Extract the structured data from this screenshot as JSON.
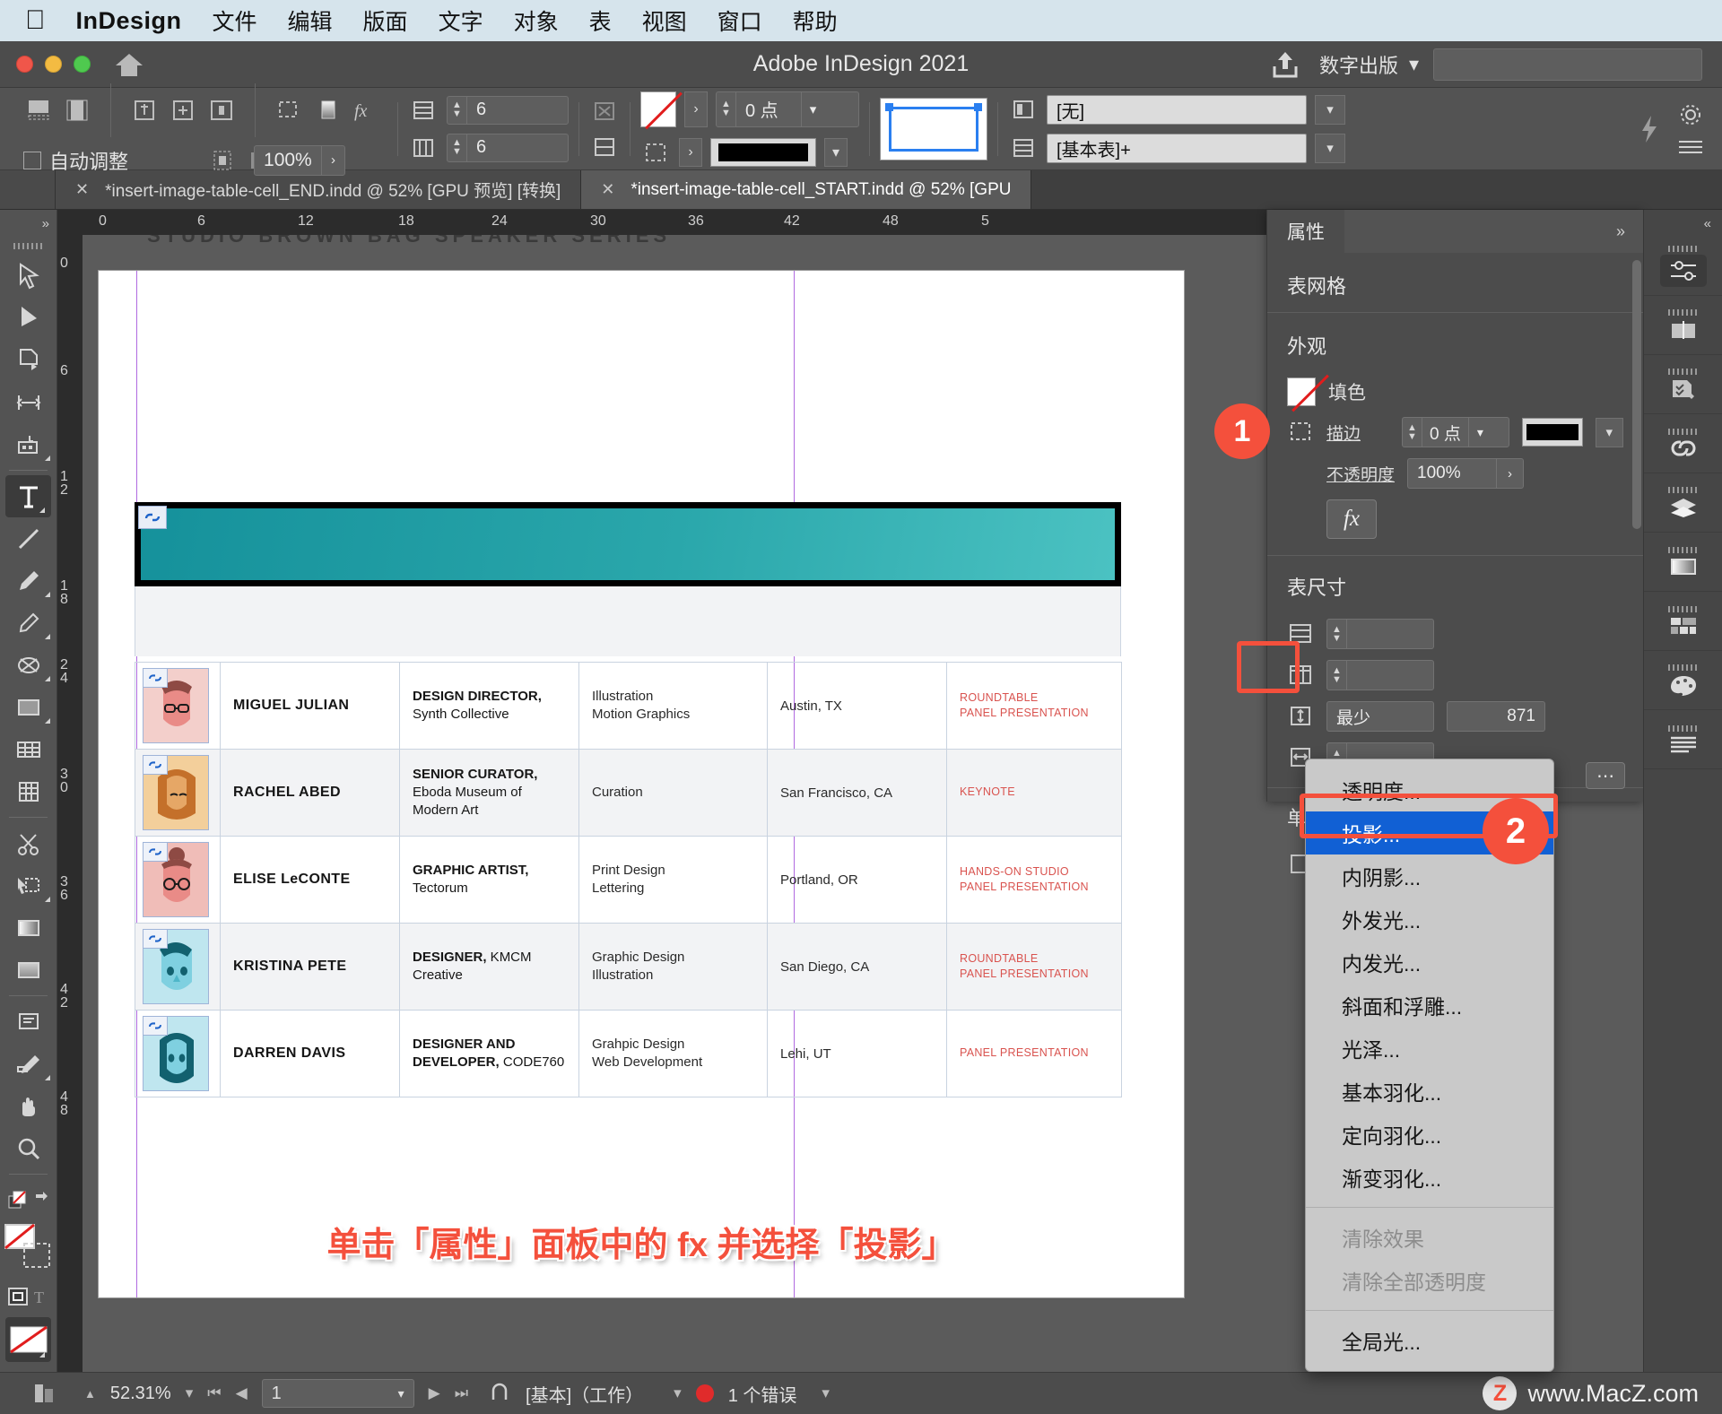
{
  "macbar": {
    "apple_icon": "apple-icon",
    "app_name": "InDesign",
    "menus": [
      "文件",
      "编辑",
      "版面",
      "文字",
      "对象",
      "表",
      "视图",
      "窗口",
      "帮助"
    ]
  },
  "titlebar": {
    "title": "Adobe InDesign 2021",
    "share_icon": "share-icon",
    "home_icon": "home-icon",
    "workspace": "数字出版",
    "search_placeholder": ""
  },
  "control_bar": {
    "auto_fit_label": "自动调整",
    "scale_value": "100%",
    "rows_value": "6",
    "cols_value": "6",
    "stroke_weight": "0 点",
    "object_style": "[无]",
    "table_style": "[基本表]+",
    "fill_swatch": "none-swatch",
    "stroke_swatch": "black-swatch"
  },
  "tabs": [
    {
      "label": "*insert-image-table-cell_END.indd @ 52% [GPU 预览] [转换]",
      "active": false
    },
    {
      "label": "*insert-image-table-cell_START.indd @ 52% [GPU",
      "active": true
    }
  ],
  "tools": [
    "selection-tool",
    "direct-selection-tool",
    "page-tool",
    "gap-tool",
    "content-collector-tool",
    "type-tool",
    "line-tool",
    "pen-tool",
    "pencil-tool",
    "ellipse-frame-tool",
    "rectangle-tool",
    "table-tool",
    "column-tool",
    "scissors-tool",
    "free-transform-tool",
    "gradient-swatch-tool",
    "gradient-feather-tool",
    "note-tool",
    "eyedropper-tool",
    "hand-tool",
    "zoom-tool"
  ],
  "rulers": {
    "horizontal_ticks": [
      "0",
      "6",
      "12",
      "18",
      "24",
      "30",
      "36",
      "42",
      "48",
      "5"
    ],
    "vertical_ticks": [
      "0",
      "6",
      "12",
      "18",
      "24",
      "30",
      "36",
      "42",
      "48"
    ]
  },
  "document": {
    "page_header": "STUDIO BROWN BAG SPEAKER SERIES",
    "caption": "单击「属性」面板中的 fx 并选择「投影」",
    "table": {
      "rows": [
        {
          "avatar": "avatar-miguel",
          "name": "MIGUEL JULIAN",
          "role_bold": "DESIGN DIRECTOR,",
          "role_sub": "Synth Collective",
          "skills": [
            "Illustration",
            "Motion Graphics"
          ],
          "location": "Austin, TX",
          "topic": [
            "ROUNDTABLE",
            "PANEL PRESENTATION"
          ]
        },
        {
          "avatar": "avatar-rachel",
          "name": "RACHEL ABED",
          "role_bold": "SENIOR CURATOR,",
          "role_sub": "Eboda Museum of Modern Art",
          "skills": [
            "Curation"
          ],
          "location": "San Francisco, CA",
          "topic": [
            "KEYNOTE"
          ]
        },
        {
          "avatar": "avatar-elise",
          "name": "ELISE LeCONTE",
          "role_bold": "GRAPHIC ARTIST,",
          "role_sub": "Tectorum",
          "skills": [
            "Print Design",
            "Lettering"
          ],
          "location": "Portland, OR",
          "topic": [
            "HANDS-ON STUDIO",
            "PANEL PRESENTATION"
          ]
        },
        {
          "avatar": "avatar-kristina",
          "name": "KRISTINA PETE",
          "role_bold": "DESIGNER,",
          "role_sub_inline": " KMCM",
          "role_sub": "Creative",
          "skills": [
            "Graphic Design",
            "Illustration"
          ],
          "location": "San Diego, CA",
          "topic": [
            "ROUNDTABLE",
            "PANEL PRESENTATION"
          ]
        },
        {
          "avatar": "avatar-darren",
          "name": "DARREN DAVIS",
          "role_bold": "DESIGNER AND DEVELOPER,",
          "role_sub_inline": " CODE760",
          "role_sub": "",
          "skills": [
            "Grahpic Design",
            "Web Development"
          ],
          "location": "Lehi, UT",
          "topic": [
            "PANEL PRESENTATION"
          ]
        }
      ]
    }
  },
  "properties_panel": {
    "tab_label": "属性",
    "collapse_icon": "chevron-double-right-icon",
    "object_type": "表网格",
    "appearance_title": "外观",
    "fill_label": "填色",
    "stroke_label": "描边",
    "stroke_weight": "0 点",
    "opacity_label": "不透明度",
    "opacity_value": "100%",
    "fx_label": "fx",
    "table_size_title": "表尺寸",
    "table_size_min": "最少",
    "table_size_value": "871",
    "cell_inset_title": "单元格内"
  },
  "effects_menu": {
    "items": [
      {
        "label": "透明度...",
        "state": "normal"
      },
      {
        "label": "投影...",
        "state": "highlighted"
      },
      {
        "label": "内阴影...",
        "state": "normal"
      },
      {
        "label": "外发光...",
        "state": "normal"
      },
      {
        "label": "内发光...",
        "state": "normal"
      },
      {
        "label": "斜面和浮雕...",
        "state": "normal"
      },
      {
        "label": "光泽...",
        "state": "normal"
      },
      {
        "label": "基本羽化...",
        "state": "normal"
      },
      {
        "label": "定向羽化...",
        "state": "normal"
      },
      {
        "label": "渐变羽化...",
        "state": "normal"
      },
      {
        "label": "清除效果",
        "state": "disabled"
      },
      {
        "label": "清除全部透明度",
        "state": "disabled"
      },
      {
        "label": "全局光...",
        "state": "normal"
      }
    ]
  },
  "callouts": [
    {
      "number": "1"
    },
    {
      "number": "2"
    }
  ],
  "dock": [
    "properties-panel-icon",
    "pages-panel-icon",
    "preflight-panel-icon",
    "links-panel-icon",
    "layers-panel-icon",
    "gradient-panel-icon",
    "object-styles-panel-icon",
    "swatches-panel-icon",
    "paragraph-styles-panel-icon"
  ],
  "status_bar": {
    "zoom": "52.31%",
    "page": "1",
    "workspace": "[基本]（工作）",
    "errors": "1 个错误",
    "watermark": "www.MacZ.com",
    "watermark_logo": "Z"
  },
  "colors": {
    "accent_red": "#f4503c",
    "menu_highlight": "#1160d4",
    "banner_teal": "#15919b",
    "topic_red": "#d9534f",
    "error_red": "#e02b2b"
  }
}
